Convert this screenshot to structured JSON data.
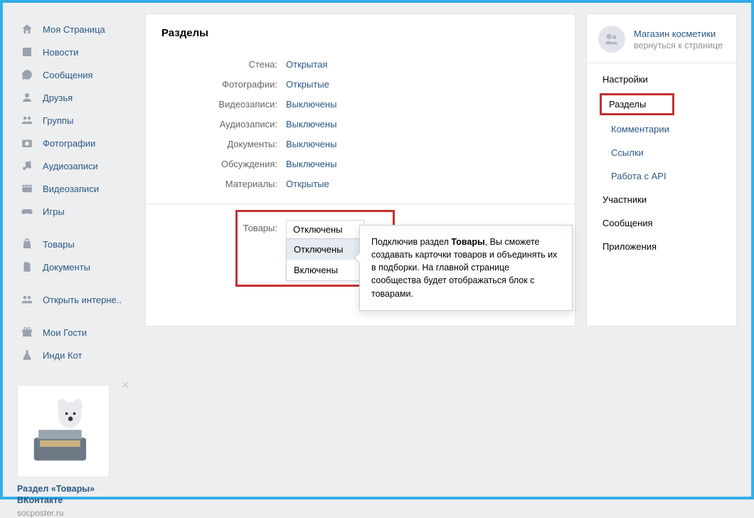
{
  "leftnav": {
    "group1": [
      {
        "icon": "home",
        "label": "Моя Страница"
      },
      {
        "icon": "news",
        "label": "Новости"
      },
      {
        "icon": "msg",
        "label": "Сообщения"
      },
      {
        "icon": "user",
        "label": "Друзья"
      },
      {
        "icon": "group",
        "label": "Группы"
      },
      {
        "icon": "photo",
        "label": "Фотографии"
      },
      {
        "icon": "audio",
        "label": "Аудиозаписи"
      },
      {
        "icon": "video",
        "label": "Видеозаписи"
      },
      {
        "icon": "game",
        "label": "Игры"
      }
    ],
    "group2": [
      {
        "icon": "bag",
        "label": "Товары"
      },
      {
        "icon": "doc",
        "label": "Документы"
      }
    ],
    "group3": [
      {
        "icon": "group",
        "label": "Открыть интерне.."
      }
    ],
    "group4": [
      {
        "icon": "gift",
        "label": "Мои Гости"
      },
      {
        "icon": "flask",
        "label": "Инди Кот"
      }
    ]
  },
  "promo": {
    "title": "Раздел «Товары» ВКонтакте",
    "sub": "socposter.ru"
  },
  "main": {
    "title": "Разделы",
    "rows": [
      {
        "label": "Стена:",
        "value": "Открытая"
      },
      {
        "label": "Фотографии:",
        "value": "Открытые"
      },
      {
        "label": "Видеозаписи:",
        "value": "Выключены"
      },
      {
        "label": "Аудиозаписи:",
        "value": "Выключены"
      },
      {
        "label": "Документы:",
        "value": "Выключены"
      },
      {
        "label": "Обсуждения:",
        "value": "Выключены"
      },
      {
        "label": "Материалы:",
        "value": "Открытые"
      }
    ],
    "goods": {
      "label": "Товары:",
      "current": "Отключены",
      "options": [
        "Отключены",
        "Включены"
      ]
    }
  },
  "tooltip": {
    "pre": "Подключив раздел ",
    "bold": "Товары",
    "post": ", Вы сможете создавать карточки товаров и объединять их в подборки. На главной странице сообщества будет отображаться блок с товарами."
  },
  "right": {
    "community": "Магазин косметики",
    "back": "вернуться к странице",
    "items": [
      {
        "label": "Настройки",
        "type": "grp"
      },
      {
        "label": "Разделы",
        "type": "active"
      },
      {
        "label": "Комментарии",
        "type": "sub"
      },
      {
        "label": "Ссылки",
        "type": "sub"
      },
      {
        "label": "Работа с API",
        "type": "sub"
      },
      {
        "label": "Участники",
        "type": "grp"
      },
      {
        "label": "Сообщения",
        "type": "grp"
      },
      {
        "label": "Приложения",
        "type": "grp"
      }
    ]
  }
}
